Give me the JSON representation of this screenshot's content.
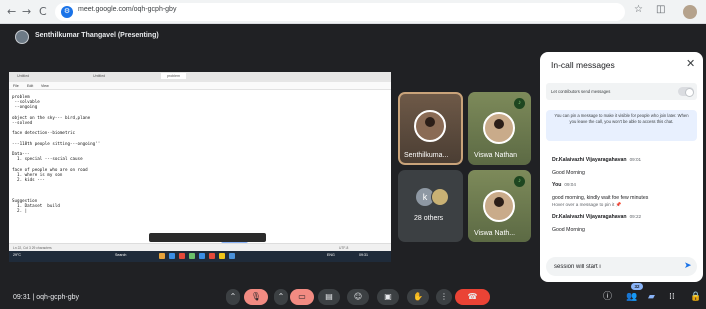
{
  "browser": {
    "back": "←",
    "forward": "→",
    "reload": "C",
    "url": "meet.google.com/oqh-gcph-gby",
    "star": "☆",
    "ext": "◫"
  },
  "header": {
    "presenter": "Senthilkumar Thangavel (Presenting)"
  },
  "presentation": {
    "tabs": [
      "Untitled",
      "Untitled",
      "problem"
    ],
    "menu": [
      "File",
      "Edit",
      "View"
    ],
    "content": "problem\n --solvable\n --ongoing\n\nobject on the sky--- bird,plane\n--solved\n\nface detection--biometric\n\n---118th people sitting---ongoing''\n\nData---\n  1. special ---social cause\n\nface of people who are on road\n  1. where is my son\n  2. kids ---\n\n\n\nSuggestion\n  1. Dataset  build\n  2. |",
    "status_left": "Ln 22, Col 3   29 characters",
    "status_right": "UTF-8",
    "share_text": "meet.google.com is sharing your screen",
    "stop_label": "Stop sharing",
    "hide_label": "Hide",
    "weather": "29°C",
    "search": "Search",
    "lang": "ENG",
    "time": "09:31"
  },
  "tiles": {
    "senthil": "Senthilkuma...",
    "viswa1": "Viswa Nathan",
    "others_initial": "k",
    "others_count": "28 others",
    "viswa2": "Viswa Nath..."
  },
  "chat": {
    "title": "In-call messages",
    "close": "✕",
    "toggle_label": "Let contributors send messages",
    "pin_note": "You can pin a message to make it visible for people who join later. When you leave the call, you won't be able to access this chat.",
    "messages": [
      {
        "sender": "Dr.Kalaivazhi Vijayaragahavan",
        "time": "09:01",
        "text": "Good Morning",
        "hint": ""
      },
      {
        "sender": "You",
        "time": "09:04",
        "text": "good morning, kindly wait foe few minutes",
        "hint": "Hover over a message to pin it"
      },
      {
        "sender": "Dr.Kalaivazhi Vijayaragahavan",
        "time": "09:22",
        "text": "Good Morning",
        "hint": ""
      }
    ],
    "input_value": "session will start i",
    "send": "➤"
  },
  "bottom": {
    "clock": "09:31  |  oqh-gcph-gby",
    "participants_badge": "32"
  }
}
